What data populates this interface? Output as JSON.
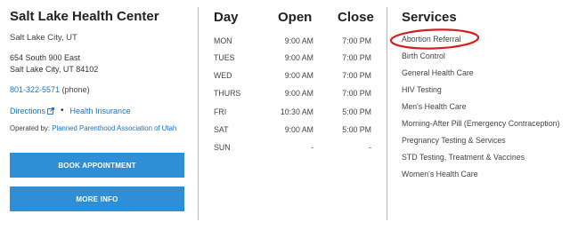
{
  "center": {
    "name": "Salt Lake Health Center",
    "city": "Salt Lake City, UT",
    "address_line1": "654 South 900 East",
    "address_line2": "Salt Lake City, UT 84102",
    "phone": "801-322-5571",
    "phone_suffix": "(phone)",
    "directions_label": "Directions",
    "insurance_label": "Health Insurance",
    "operated_prefix": "Operated by:",
    "operator": "Planned Parenthood Association of Utah",
    "book_label": "BOOK APPOINTMENT",
    "more_label": "MORE INFO"
  },
  "hours": {
    "headers": {
      "day": "Day",
      "open": "Open",
      "close": "Close"
    },
    "rows": [
      {
        "day": "MON",
        "open": "9:00 AM",
        "close": "7:00 PM"
      },
      {
        "day": "TUES",
        "open": "9:00 AM",
        "close": "7:00 PM"
      },
      {
        "day": "WED",
        "open": "9:00 AM",
        "close": "7:00 PM"
      },
      {
        "day": "THURS",
        "open": "9:00 AM",
        "close": "7:00 PM"
      },
      {
        "day": "FRI",
        "open": "10:30 AM",
        "close": "5:00 PM"
      },
      {
        "day": "SAT",
        "open": "9:00 AM",
        "close": "5:00 PM"
      },
      {
        "day": "SUN",
        "open": "-",
        "close": "-"
      }
    ]
  },
  "services": {
    "title": "Services",
    "items": [
      "Abortion Referral",
      "Birth Control",
      "General Health Care",
      "HIV Testing",
      "Men's Health Care",
      "Morning-After Pill (Emergency Contraception)",
      "Pregnancy Testing & Services",
      "STD Testing, Treatment & Vaccines",
      "Women's Health Care"
    ]
  },
  "colors": {
    "link": "#1a73c9",
    "button": "#2e8fd6",
    "highlight_circle": "#d42020"
  },
  "icons": {
    "directions_link": "external-link-icon"
  }
}
